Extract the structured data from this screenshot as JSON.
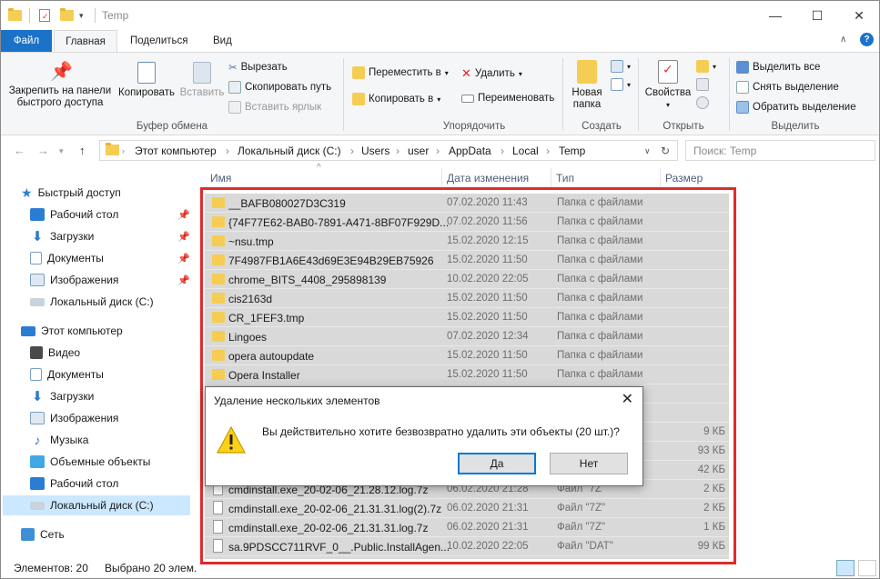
{
  "window": {
    "title": "Temp",
    "min": "—",
    "max": "☐",
    "close": "✕"
  },
  "tabs": {
    "file": "Файл",
    "home": "Главная",
    "share": "Поделиться",
    "view": "Вид"
  },
  "ribbon": {
    "pin": "Закрепить на панели быстрого доступа",
    "pin_l1": "Закрепить на панели",
    "pin_l2": "быстрого доступа",
    "copy": "Копировать",
    "paste": "Вставить",
    "cut": "Вырезать",
    "copy_path": "Скопировать путь",
    "paste_shortcut": "Вставить ярлык",
    "clipboard_group": "Буфер обмена",
    "move_to": "Переместить в",
    "copy_to": "Копировать в",
    "delete": "Удалить",
    "rename": "Переименовать",
    "organize_group": "Упорядочить",
    "new_folder_l1": "Новая",
    "new_folder_l2": "папка",
    "create_group": "Создать",
    "properties": "Свойства",
    "open_group": "Открыть",
    "select_all": "Выделить все",
    "select_none": "Снять выделение",
    "invert_selection": "Обратить выделение",
    "select_group": "Выделить"
  },
  "address": {
    "crumbs": [
      "Этот компьютер",
      "Локальный диск (C:)",
      "Users",
      "user",
      "AppData",
      "Local",
      "Temp"
    ],
    "search_placeholder": "Поиск: Temp"
  },
  "sidebar": {
    "quick_access": "Быстрый доступ",
    "qa_items": [
      "Рабочий стол",
      "Загрузки",
      "Документы",
      "Изображения",
      "Локальный диск (C:)"
    ],
    "this_pc": "Этот компьютер",
    "pc_items": [
      "Видео",
      "Документы",
      "Загрузки",
      "Изображения",
      "Музыка",
      "Объемные объекты",
      "Рабочий стол",
      "Локальный диск (C:)"
    ],
    "network": "Сеть"
  },
  "columns": {
    "name": "Имя",
    "date": "Дата изменения",
    "type": "Тип",
    "size": "Размер"
  },
  "rows": [
    {
      "name": "__BAFB080027D3C319",
      "date": "07.02.2020 11:43",
      "type": "Папка с файлами",
      "size": "",
      "kind": "folder"
    },
    {
      "name": "{74F77E62-BAB0-7891-A471-8BF07F929D...",
      "date": "07.02.2020 11:56",
      "type": "Папка с файлами",
      "size": "",
      "kind": "folder"
    },
    {
      "name": "~nsu.tmp",
      "date": "15.02.2020 12:15",
      "type": "Папка с файлами",
      "size": "",
      "kind": "folder"
    },
    {
      "name": "7F4987FB1A6E43d69E3E94B29EB75926",
      "date": "15.02.2020 11:50",
      "type": "Папка с файлами",
      "size": "",
      "kind": "folder"
    },
    {
      "name": "chrome_BITS_4408_295898139",
      "date": "10.02.2020 22:05",
      "type": "Папка с файлами",
      "size": "",
      "kind": "folder"
    },
    {
      "name": "cis2163d",
      "date": "15.02.2020 11:50",
      "type": "Папка с файлами",
      "size": "",
      "kind": "folder"
    },
    {
      "name": "CR_1FEF3.tmp",
      "date": "15.02.2020 11:50",
      "type": "Папка с файлами",
      "size": "",
      "kind": "folder"
    },
    {
      "name": "Lingoes",
      "date": "07.02.2020 12:34",
      "type": "Папка с файлами",
      "size": "",
      "kind": "folder"
    },
    {
      "name": "opera autoupdate",
      "date": "15.02.2020 11:50",
      "type": "Папка с файлами",
      "size": "",
      "kind": "folder"
    },
    {
      "name": "Opera Installer",
      "date": "15.02.2020 11:50",
      "type": "Папка с файлами",
      "size": "",
      "kind": "folder"
    },
    {
      "name": "",
      "date": "",
      "type": "",
      "size": "",
      "kind": "hidden"
    },
    {
      "name": "",
      "date": "",
      "type": "",
      "size": "",
      "kind": "hidden"
    },
    {
      "name": "",
      "date": "",
      "type": "",
      "size": "9 КБ",
      "kind": "file"
    },
    {
      "name": "",
      "date": "",
      "type": "",
      "size": "93 КБ",
      "kind": "file"
    },
    {
      "name": "",
      "date": "",
      "type": "",
      "size": "42 КБ",
      "kind": "file"
    },
    {
      "name": "cmdinstall.exe_20-02-06_21.28.12.log.7z",
      "date": "06.02.2020 21:28",
      "type": "Файл \"7Z\"",
      "size": "2 КБ",
      "kind": "file"
    },
    {
      "name": "cmdinstall.exe_20-02-06_21.31.31.log(2).7z",
      "date": "06.02.2020 21:31",
      "type": "Файл \"7Z\"",
      "size": "2 КБ",
      "kind": "file"
    },
    {
      "name": "cmdinstall.exe_20-02-06_21.31.31.log.7z",
      "date": "06.02.2020 21:31",
      "type": "Файл \"7Z\"",
      "size": "1 КБ",
      "kind": "file"
    },
    {
      "name": "sa.9PDSCC711RVF_0__.Public.InstallAgen...",
      "date": "10.02.2020 22:05",
      "type": "Файл \"DAT\"",
      "size": "99 КБ",
      "kind": "file"
    }
  ],
  "dialog": {
    "title": "Удаление нескольких элементов",
    "message": "Вы действительно хотите безвозвратно удалить эти объекты (20 шт.)?",
    "yes": "Да",
    "no": "Нет"
  },
  "status": {
    "count": "Элементов: 20",
    "selected": "Выбрано 20 элем."
  },
  "colors": {
    "accent": "#1a73c8",
    "selection": "#d9d9d9",
    "highlight": "#e02b2b"
  }
}
